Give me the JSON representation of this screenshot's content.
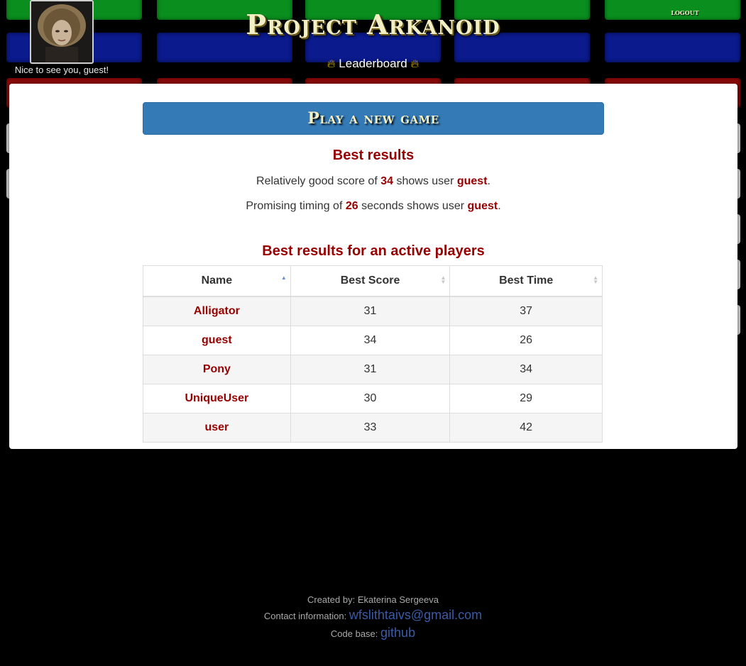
{
  "header": {
    "app_title": "Project Arkanoid",
    "greeting": "Nice to see you, guest!",
    "leaderboard_label": "Leaderboard",
    "logout_label": "logout"
  },
  "main": {
    "play_button": "Play a new game",
    "best_results_title": "Best results",
    "best_score_line": {
      "prefix": "Relatively good score of",
      "value": "34",
      "middle": "shows user",
      "user": "guest",
      "suffix": "."
    },
    "best_time_line": {
      "prefix": "Promising timing of",
      "value": "26",
      "middle": "seconds shows user",
      "user": "guest",
      "suffix": "."
    },
    "active_title": "Best results for an active players",
    "table": {
      "columns": [
        "Name",
        "Best Score",
        "Best Time"
      ],
      "rows": [
        {
          "name": "Alligator",
          "score": "31",
          "time": "37"
        },
        {
          "name": "guest",
          "score": "34",
          "time": "26"
        },
        {
          "name": "Pony",
          "score": "31",
          "time": "34"
        },
        {
          "name": "UniqueUser",
          "score": "30",
          "time": "29"
        },
        {
          "name": "user",
          "score": "33",
          "time": "42"
        }
      ]
    }
  },
  "footer": {
    "created_label": "Created by:",
    "created_name": "Ekaterina Sergeeva",
    "contact_label": "Contact information:",
    "contact_email": "wfslithtaivs@gmail.com",
    "code_label": "Code base:",
    "code_link": "github"
  },
  "icons": {
    "flame": "flame-icon"
  },
  "colors": {
    "accent_red": "#990000",
    "button_blue": "#337ab7",
    "title_cream": "#f3efc4"
  }
}
